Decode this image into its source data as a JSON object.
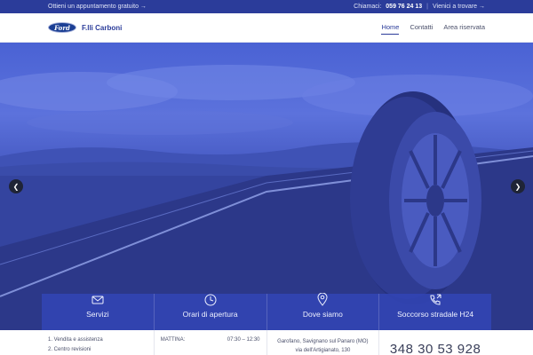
{
  "topbar": {
    "appointment": "Ottieni un appuntamento gratuito →",
    "call_label": "Chiamaci:",
    "phone": "059 76 24 13",
    "visit": "Vienici a trovare →"
  },
  "header": {
    "logo_text": "Ford",
    "brand": "F.lli Carboni",
    "nav": [
      {
        "label": "Home",
        "active": true
      },
      {
        "label": "Contatti",
        "active": false
      },
      {
        "label": "Area riservata",
        "active": false
      }
    ]
  },
  "slider": {
    "prev_icon": "chevron-left-icon",
    "next_icon": "chevron-right-icon"
  },
  "services": [
    {
      "label": "Servizi",
      "icon": "mail-icon"
    },
    {
      "label": "Orari di apertura",
      "icon": "clock-icon"
    },
    {
      "label": "Dove siamo",
      "icon": "map-pin-icon"
    },
    {
      "label": "Soccorso stradale H24",
      "icon": "phone-call-icon"
    }
  ],
  "info": {
    "service_list": [
      "1.  Vendita e assistenza",
      "2.  Centro revisioni"
    ],
    "hours_label": "MATTINA:",
    "hours_value": "07:30 – 12:30",
    "address_line1": "Garofano, Savignano sul Panaro (MO)",
    "address_line2": "via dell'Artigianato, 130",
    "emergency_phone": "348 30 53 928"
  },
  "colors": {
    "brand_blue": "#2b3c9a",
    "overlay_blue": "#3244b4"
  }
}
